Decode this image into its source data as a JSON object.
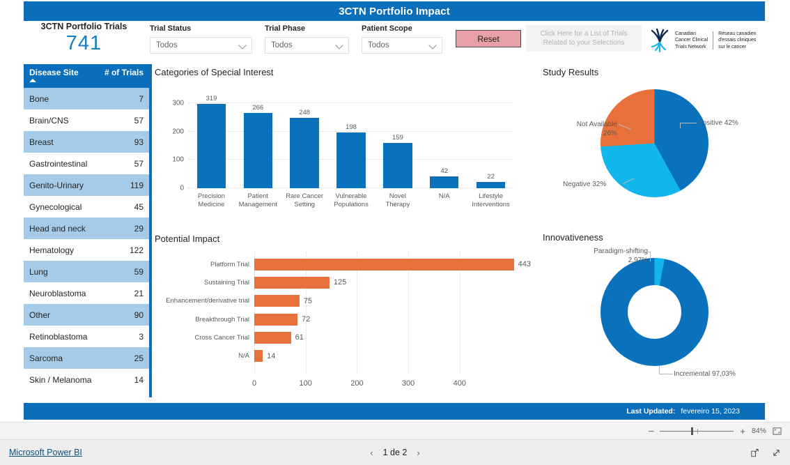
{
  "header": {
    "title": "3CTN Portfolio Impact",
    "bar_color": "#0b6eba"
  },
  "kpi": {
    "label": "3CTN Portfolio Trials",
    "value": "741"
  },
  "slicers": [
    {
      "label": "Trial Status",
      "value": "Todos"
    },
    {
      "label": "Trial Phase",
      "value": "Todos"
    },
    {
      "label": "Patient Scope",
      "value": "Todos"
    }
  ],
  "reset_button": {
    "label": "Reset",
    "color": "#e8a0a7"
  },
  "click_here": {
    "line1": "Click Here for a List of Trials Related",
    "line2": "to your Selections"
  },
  "logo": {
    "en_line1": "Canadian",
    "en_line2": "Cancer Clinical",
    "en_line3": "Trials Network",
    "fr_line1": "Réseau canadien",
    "fr_line2": "d'essais cliniques",
    "fr_line3": "sur le cancer"
  },
  "disease_table": {
    "columns": [
      "Disease Site",
      "# of Trials"
    ],
    "rows": [
      {
        "name": "Bone",
        "count": "7"
      },
      {
        "name": "Brain/CNS",
        "count": "57"
      },
      {
        "name": "Breast",
        "count": "93"
      },
      {
        "name": "Gastrointestinal",
        "count": "57"
      },
      {
        "name": "Genito-Urinary",
        "count": "119"
      },
      {
        "name": "Gynecological",
        "count": "45"
      },
      {
        "name": "Head and neck",
        "count": "29"
      },
      {
        "name": "Hematology",
        "count": "122"
      },
      {
        "name": "Lung",
        "count": "59"
      },
      {
        "name": "Neuroblastoma",
        "count": "21"
      },
      {
        "name": "Other",
        "count": "90"
      },
      {
        "name": "Retinoblastoma",
        "count": "3"
      },
      {
        "name": "Sarcoma",
        "count": "25"
      },
      {
        "name": "Skin / Melanoma",
        "count": "14"
      }
    ]
  },
  "footer": {
    "label": "Last Updated:",
    "date": "fevereiro 15, 2023"
  },
  "zoom_toolbar": {
    "minus": "–",
    "plus": "+",
    "percent": "84%"
  },
  "bottom_bar": {
    "brand": "Microsoft Power BI",
    "page": "1 de 2",
    "prev": "‹",
    "next": "›"
  },
  "chart_data": [
    {
      "id": "categories_of_special_interest",
      "type": "bar",
      "title": "Categories of Special Interest",
      "orientation": "vertical",
      "categories": [
        "Precision Medicine",
        "Patient Management",
        "Rare Cancer Setting",
        "Vulnerable Populations",
        "Novel Therapy",
        "N/A",
        "Lifestyle Interventions"
      ],
      "values": [
        319,
        266,
        248,
        198,
        159,
        42,
        22
      ],
      "yticks": [
        0,
        100,
        200,
        300
      ],
      "ylim": [
        0,
        330
      ],
      "xlabel": "",
      "ylabel": "",
      "grid": true,
      "legend": "none",
      "color": "#0a72bc"
    },
    {
      "id": "potential_impact",
      "type": "bar",
      "title": "Potential Impact",
      "orientation": "horizontal",
      "categories": [
        "Platform Trial",
        "Sustaining Trial",
        "Enhancement/derivative trial",
        "Breakthrough Trial",
        "Cross Cancer Trial",
        "N/A"
      ],
      "values": [
        443,
        125,
        75,
        72,
        61,
        14
      ],
      "xticks": [
        0,
        100,
        200,
        300,
        400
      ],
      "xlim": [
        0,
        460
      ],
      "xlabel": "",
      "ylabel": "",
      "grid": true,
      "legend": "none",
      "color": "#e8703a"
    },
    {
      "id": "study_results",
      "type": "pie",
      "title": "Study Results",
      "labels": [
        "Positive",
        "Negative",
        "Not Available"
      ],
      "values": [
        42,
        32,
        26
      ],
      "label_texts": [
        "Positive 42%",
        "Negative 32%",
        "Not Available\n26%"
      ],
      "colors": [
        "#0a72bc",
        "#12b5ec",
        "#e8703a"
      ],
      "legend": "callout-labels"
    },
    {
      "id": "innovativeness",
      "type": "pie",
      "subtype": "donut",
      "title": "Innovativeness",
      "labels": [
        "Incremental",
        "Paradigm-shifting"
      ],
      "values": [
        97.03,
        2.97
      ],
      "label_texts": [
        "Incremental 97,03%",
        "Paradigm-shifting\n2,97%"
      ],
      "colors": [
        "#0a72bc",
        "#12b5ec"
      ],
      "legend": "callout-labels"
    }
  ],
  "labels": {
    "cat_title": "Categories of Special Interest",
    "impact_title": "Potential Impact",
    "study_title": "Study Results",
    "inno_title": "Innovativeness",
    "cat_y": [
      "300",
      "200",
      "100",
      "0"
    ],
    "cat_cats": [
      "Precision\nMedicine",
      "Patient\nManagement",
      "Rare Cancer\nSetting",
      "Vulnerable\nPopulations",
      "Novel\nTherapy",
      "N/A",
      "Lifestyle\nInterventions"
    ],
    "cat_vals": [
      "319",
      "266",
      "248",
      "198",
      "159",
      "42",
      "22"
    ],
    "imp_cats": [
      "Platform Trial",
      "Sustaining Trial",
      "Enhancement/derivative trial",
      "Breakthrough Trial",
      "Cross Cancer Trial",
      "N/A"
    ],
    "imp_vals": [
      "443",
      "125",
      "75",
      "72",
      "61",
      "14"
    ],
    "imp_ticks": [
      "0",
      "100",
      "200",
      "300",
      "400"
    ],
    "pie_positive": "Positive 42%",
    "pie_negative": "Negative 32%",
    "pie_na_l1": "Not Available",
    "pie_na_l2": "26%",
    "dn_para_l1": "Paradigm-shifting",
    "dn_para_l2": "2,97%",
    "dn_incr": "Incremental 97,03%"
  }
}
